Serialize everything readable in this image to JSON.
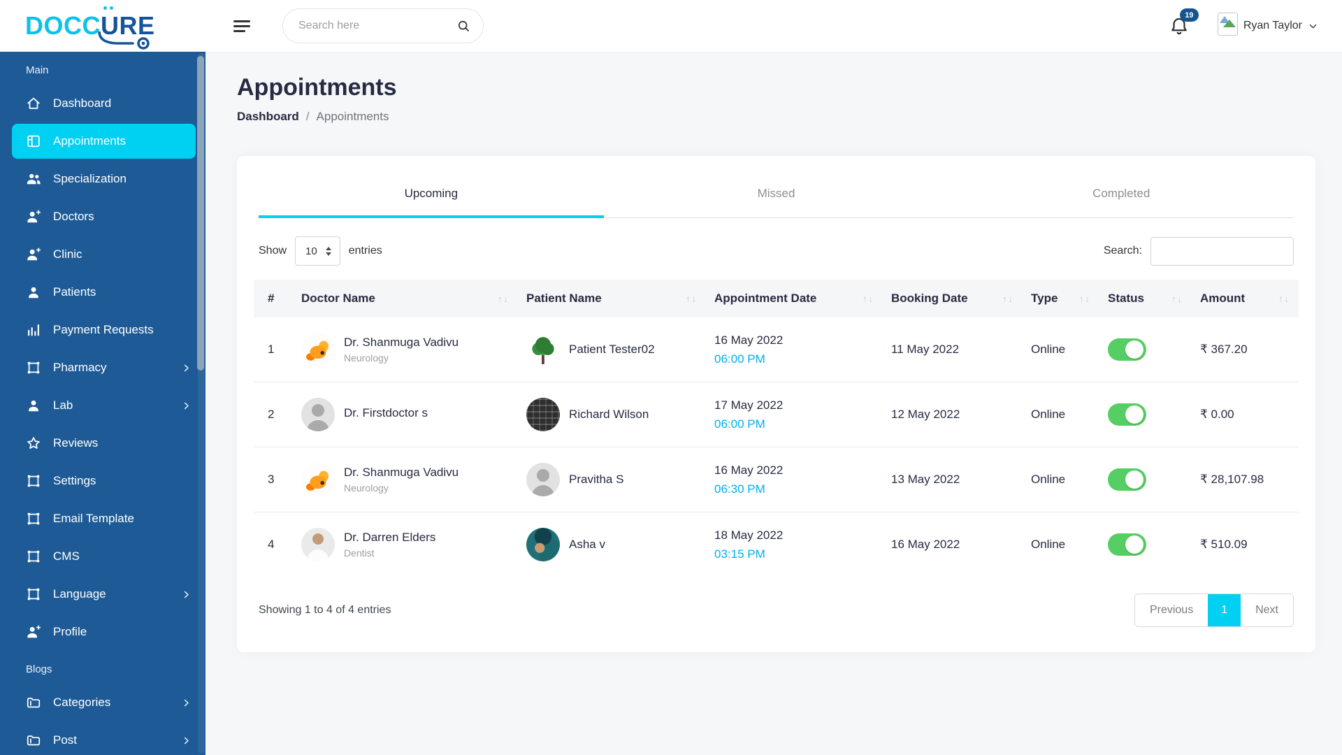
{
  "brand": {
    "part1": "DOCC",
    "part2": "U",
    "part3": "RE"
  },
  "header": {
    "search_placeholder": "Search here",
    "notification_count": "19",
    "user_name": "Ryan Taylor"
  },
  "sidebar": {
    "sections": [
      {
        "label": "Main",
        "items": [
          {
            "label": "Dashboard",
            "icon": "home-icon",
            "active": false
          },
          {
            "label": "Appointments",
            "icon": "layout-icon",
            "active": true
          },
          {
            "label": "Specialization",
            "icon": "people-icon",
            "active": false
          },
          {
            "label": "Doctors",
            "icon": "person-add-icon",
            "active": false
          },
          {
            "label": "Clinic",
            "icon": "person-add-icon",
            "active": false
          },
          {
            "label": "Patients",
            "icon": "person-icon",
            "active": false
          },
          {
            "label": "Payment Requests",
            "icon": "bar-chart-icon",
            "active": false
          },
          {
            "label": "Pharmacy",
            "icon": "frame-icon",
            "submenu": true
          },
          {
            "label": "Lab",
            "icon": "person-icon",
            "submenu": true
          },
          {
            "label": "Reviews",
            "icon": "star-icon",
            "active": false
          },
          {
            "label": "Settings",
            "icon": "frame-icon",
            "active": false
          },
          {
            "label": "Email Template",
            "icon": "frame-icon",
            "active": false
          },
          {
            "label": "CMS",
            "icon": "frame-icon",
            "active": false
          },
          {
            "label": "Language",
            "icon": "frame-icon",
            "submenu": true
          },
          {
            "label": "Profile",
            "icon": "person-add-icon",
            "active": false
          }
        ]
      },
      {
        "label": "Blogs",
        "items": [
          {
            "label": "Categories",
            "icon": "folder-icon",
            "submenu": true
          },
          {
            "label": "Post",
            "icon": "folder-icon",
            "submenu": true
          }
        ]
      }
    ]
  },
  "page": {
    "title": "Appointments",
    "breadcrumb": [
      "Dashboard",
      "Appointments"
    ],
    "breadcrumb_sep": "/"
  },
  "tabs": [
    {
      "label": "Upcoming",
      "active": true
    },
    {
      "label": "Missed",
      "active": false
    },
    {
      "label": "Completed",
      "active": false
    }
  ],
  "controls": {
    "show_label": "Show",
    "page_size": "10",
    "entries_label": "entries",
    "search_label": "Search:",
    "search_value": ""
  },
  "table": {
    "columns": [
      "#",
      "Doctor Name",
      "Patient Name",
      "Appointment Date",
      "Booking Date",
      "Type",
      "Status",
      "Amount"
    ],
    "sortable": [
      false,
      true,
      true,
      true,
      true,
      true,
      true,
      true
    ],
    "rows": [
      {
        "index": "1",
        "doctor_name": "Dr. Shanmuga Vadivu",
        "doctor_specialty": "Neurology",
        "doctor_avatar": "goldfish-photo",
        "patient_name": "Patient Tester02",
        "patient_avatar": "tree-photo",
        "appointment_date": "16 May 2022",
        "appointment_time": "06:00 PM",
        "booking_date": "11 May 2022",
        "type": "Online",
        "status_on": true,
        "amount": "₹ 367.20"
      },
      {
        "index": "2",
        "doctor_name": "Dr. Firstdoctor s",
        "doctor_specialty": "",
        "doctor_avatar": "placeholder-avatar",
        "patient_name": "Richard Wilson",
        "patient_avatar": "keyboard-photo",
        "appointment_date": "17 May 2022",
        "appointment_time": "06:00 PM",
        "booking_date": "12 May 2022",
        "type": "Online",
        "status_on": true,
        "amount": "₹ 0.00"
      },
      {
        "index": "3",
        "doctor_name": "Dr. Shanmuga Vadivu",
        "doctor_specialty": "Neurology",
        "doctor_avatar": "goldfish-photo",
        "patient_name": "Pravitha S",
        "patient_avatar": "placeholder-avatar",
        "appointment_date": "16 May 2022",
        "appointment_time": "06:30 PM",
        "booking_date": "13 May 2022",
        "type": "Online",
        "status_on": true,
        "amount": "₹ 28,107.98"
      },
      {
        "index": "4",
        "doctor_name": "Dr. Darren Elders",
        "doctor_specialty": "Dentist",
        "doctor_avatar": "doctor-photo",
        "patient_name": "Asha v",
        "patient_avatar": "portrait-illustration",
        "appointment_date": "18 May 2022",
        "appointment_time": "03:15 PM",
        "booking_date": "16 May 2022",
        "type": "Online",
        "status_on": true,
        "amount": "₹ 510.09"
      }
    ]
  },
  "footer": {
    "showing_text": "Showing 1 to 4 of 4 entries",
    "prev_label": "Previous",
    "page": "1",
    "next_label": "Next"
  },
  "colors": {
    "accent_cyan": "#00d0f1",
    "sidebar_blue": "#1e5b96",
    "logo_cyan": "#0fc1e9",
    "logo_blue": "#17539b",
    "toggle_green": "#55ce63",
    "time_blue": "#00aff0",
    "badge_blue": "#15558d",
    "heading_text": "#272b41"
  }
}
